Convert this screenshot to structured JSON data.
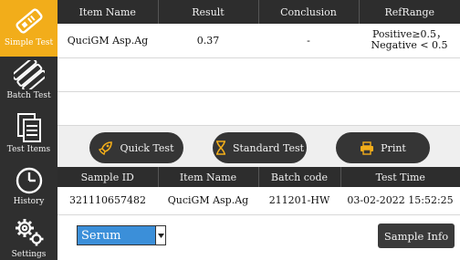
{
  "sidebar": {
    "items": [
      {
        "label": "Simple Test",
        "icon": "test-strip-icon",
        "active": true
      },
      {
        "label": "Batch Test",
        "icon": "batch-strips-icon",
        "active": false
      },
      {
        "label": "Test Items",
        "icon": "document-list-icon",
        "active": false
      },
      {
        "label": "History",
        "icon": "clock-icon",
        "active": false
      },
      {
        "label": "Settings",
        "icon": "gears-icon",
        "active": false
      }
    ]
  },
  "results_table": {
    "headers": [
      "Item Name",
      "Result",
      "Conclusion",
      "RefRange"
    ],
    "rows": [
      {
        "item_name": "QuciGM Asp.Ag",
        "result": "0.37",
        "conclusion": "-",
        "refrange_line1": "Positive≥0.5，",
        "refrange_line2": "Negative < 0.5"
      }
    ]
  },
  "actions": {
    "quick_test": "Quick Test",
    "standard_test": "Standard Test",
    "print": "Print"
  },
  "samples_table": {
    "headers": [
      "Sample ID",
      "Item Name",
      "Batch code",
      "Test Time"
    ],
    "rows": [
      {
        "sample_id": "321110657482",
        "item_name": "QuciGM Asp.Ag",
        "batch_code": "211201-HW",
        "test_time": "03-02-2022 15:52:25"
      }
    ]
  },
  "sample_type": {
    "selected": "Serum"
  },
  "sample_info_button": "Sample Info",
  "colors": {
    "active_nav": "#f2ad1a",
    "sidebar_bg": "#2f2f2f",
    "select_bg": "#3b8fd9"
  }
}
